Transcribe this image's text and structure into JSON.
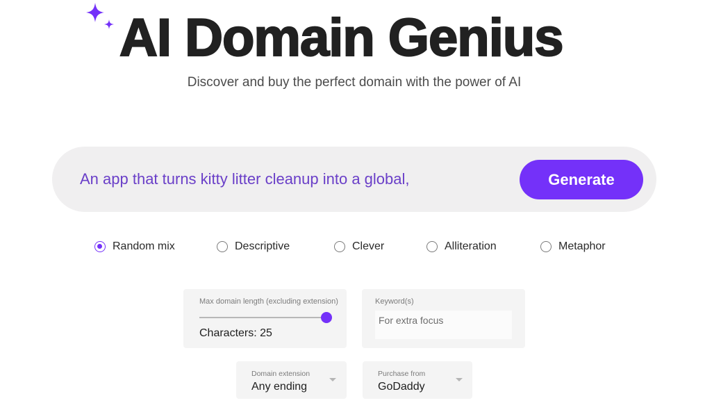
{
  "header": {
    "title": "AI Domain Genius",
    "subtitle": "Discover and buy the perfect domain with the power of AI",
    "logo_icon": "sparkles-icon"
  },
  "prompt": {
    "value": "An app that turns kitty litter cleanup into a global,",
    "generate_label": "Generate"
  },
  "styles": {
    "selected": "Random mix",
    "options": [
      "Random mix",
      "Descriptive",
      "Clever",
      "Alliteration",
      "Metaphor"
    ]
  },
  "length": {
    "label": "Max domain length (excluding extension)",
    "value_text": "Characters: 25",
    "value": 25,
    "fill_fraction": 1.0
  },
  "keywords": {
    "label": "Keyword(s)",
    "placeholder": "For extra focus",
    "value": ""
  },
  "extension": {
    "label": "Domain extension",
    "value": "Any ending"
  },
  "purchase": {
    "label": "Purchase from",
    "value": "GoDaddy"
  },
  "colors": {
    "accent": "#7431f9",
    "prompt_text": "#6a3fc8",
    "title": "#212121"
  }
}
